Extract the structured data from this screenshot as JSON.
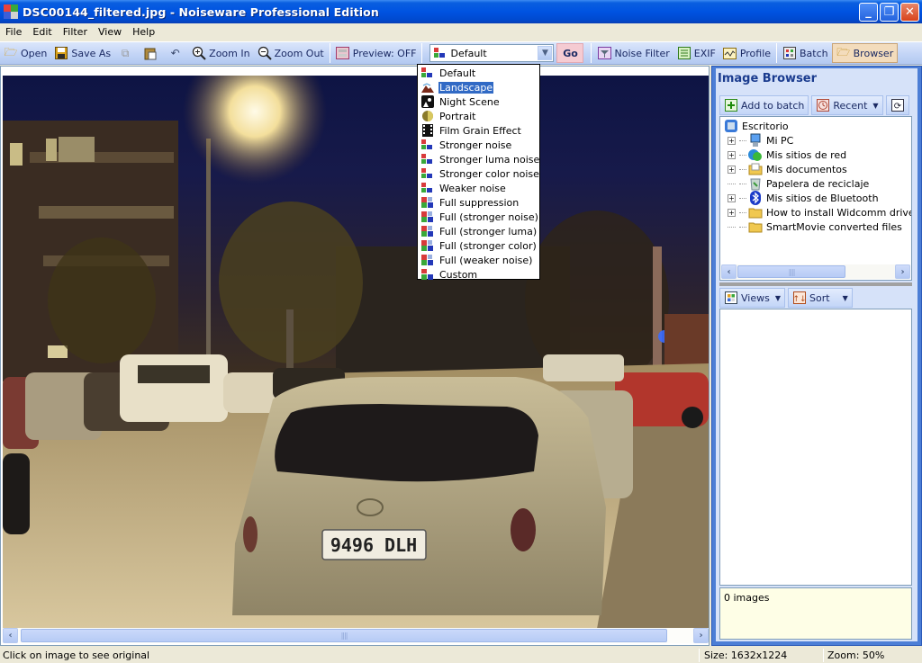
{
  "window": {
    "title": "DSC00144_filtered.jpg - Noiseware Professional Edition",
    "controls": {
      "minimize": "_",
      "maximize": "❐",
      "close": "✕"
    }
  },
  "menu": [
    "File",
    "Edit",
    "Filter",
    "View",
    "Help"
  ],
  "toolbar": {
    "open": "Open",
    "save_as": "Save As",
    "zoom_in": "Zoom In",
    "zoom_out": "Zoom Out",
    "preview": "Preview: OFF",
    "preset_selected": "Default",
    "go": "Go",
    "noise_filter": "Noise Filter",
    "exif": "EXIF",
    "profile": "Profile",
    "batch": "Batch",
    "browser": "Browser"
  },
  "preset_dropdown": {
    "selected_index": 1,
    "items": [
      {
        "label": "Default",
        "icon": "preset-default-icon"
      },
      {
        "label": "Landscape",
        "icon": "landscape-icon"
      },
      {
        "label": "Night Scene",
        "icon": "night-scene-icon"
      },
      {
        "label": "Portrait",
        "icon": "portrait-icon"
      },
      {
        "label": "Film Grain Effect",
        "icon": "film-grain-icon"
      },
      {
        "label": "Stronger noise",
        "icon": "preset-icon"
      },
      {
        "label": "Stronger luma noise",
        "icon": "preset-icon"
      },
      {
        "label": "Stronger color noise",
        "icon": "preset-icon"
      },
      {
        "label": "Weaker noise",
        "icon": "preset-icon"
      },
      {
        "label": "Full suppression",
        "icon": "preset-full-icon"
      },
      {
        "label": "Full (stronger noise)",
        "icon": "preset-full-icon"
      },
      {
        "label": "Full (stronger luma)",
        "icon": "preset-full-icon"
      },
      {
        "label": "Full (stronger color)",
        "icon": "preset-full-icon"
      },
      {
        "label": "Full (weaker noise)",
        "icon": "preset-full-icon"
      },
      {
        "label": "Custom",
        "icon": "preset-custom-icon"
      }
    ]
  },
  "image": {
    "description": "Night street scene with parked cars and a street lamp",
    "plate_text": "9496 DLH"
  },
  "image_browser": {
    "title": "Image Browser",
    "add_to_batch": "Add to batch",
    "recent": "Recent",
    "tree": [
      {
        "label": "Escritorio",
        "level": 0,
        "expander": false,
        "icon": "desktop-icon"
      },
      {
        "label": "Mi PC",
        "level": 1,
        "expander": true,
        "icon": "computer-icon"
      },
      {
        "label": "Mis sitios de red",
        "level": 1,
        "expander": true,
        "icon": "network-icon"
      },
      {
        "label": "Mis documentos",
        "level": 1,
        "expander": true,
        "icon": "documents-folder-icon"
      },
      {
        "label": "Papelera de reciclaje",
        "level": 1,
        "expander": false,
        "icon": "recycle-bin-icon"
      },
      {
        "label": "Mis sitios de Bluetooth",
        "level": 1,
        "expander": true,
        "icon": "bluetooth-icon"
      },
      {
        "label": "How to install Widcomm drivers - GS",
        "level": 1,
        "expander": true,
        "icon": "folder-icon"
      },
      {
        "label": "SmartMovie converted files",
        "level": 1,
        "expander": false,
        "icon": "folder-icon"
      }
    ],
    "views": "Views",
    "sort": "Sort",
    "image_count": "0 images"
  },
  "status": {
    "hint": "Click on image to see original",
    "size": "Size: 1632x1224",
    "zoom": "Zoom: 50%"
  },
  "colors": {
    "titlebar": "#0053e1",
    "toolbar": "#c1d3f6",
    "selection": "#316ac5",
    "panel_border": "#4c7ed6",
    "info_bg": "#fefee6"
  }
}
